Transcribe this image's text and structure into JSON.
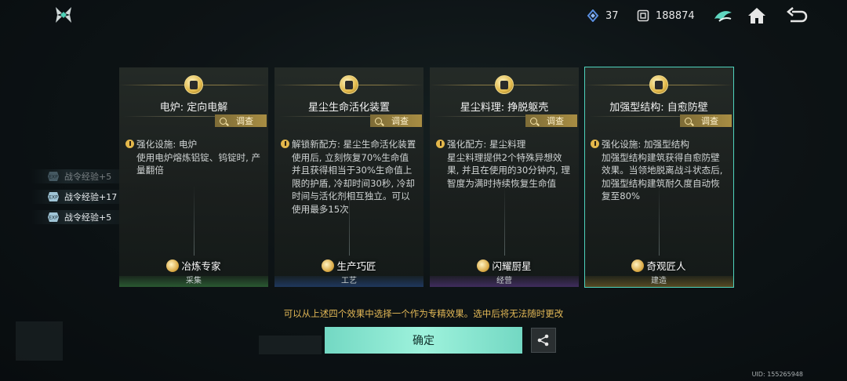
{
  "topbar": {
    "resource_a_value": "37",
    "resource_b_value": "188874",
    "icons": [
      "logo-icon",
      "crystal-icon",
      "coin-icon",
      "fleet-icon",
      "home-icon",
      "back-icon"
    ]
  },
  "exp_list": [
    {
      "label": "战令经验+5",
      "faded": true
    },
    {
      "label": "战令经验+17",
      "faded": false
    },
    {
      "label": "战令经验+5",
      "faded": false
    }
  ],
  "cards": [
    {
      "title": "电炉: 定向电解",
      "inspect_label": "调查",
      "effect_head": "强化设施: 电炉",
      "effect_desc": "使用电炉熔炼铝锭、钨锭时, 产量翻倍",
      "role": "冶炼专家",
      "category": "采集",
      "selected": false
    },
    {
      "title": "星尘生命活化装置",
      "inspect_label": "调查",
      "effect_head": "解锁新配方: 星尘生命活化装置",
      "effect_desc": "使用后, 立刻恢复70%生命值并且获得相当于30%生命值上限的护盾, 冷却时间30秒, 冷却时间与活化剂相互独立。可以使用最多15次",
      "role": "生产巧匠",
      "category": "工艺",
      "selected": false
    },
    {
      "title": "星尘料理: 挣脱躯壳",
      "inspect_label": "调查",
      "effect_head": "强化配方: 星尘料理",
      "effect_desc": "星尘料理提供2个特殊异想效果, 并且在使用的30分钟内, 理智度为满时持续恢复生命值",
      "role": "闪耀厨星",
      "category": "经营",
      "selected": false
    },
    {
      "title": "加强型结构: 自愈防壁",
      "inspect_label": "调查",
      "effect_head": "强化设施: 加强型结构",
      "effect_desc": "加强型结构建筑获得自愈防壁效果。当领地脱离战斗状态后, 加强型结构建筑耐久度自动恢复至80%",
      "role": "奇观匠人",
      "category": "建造",
      "selected": true
    }
  ],
  "notice": "可以从上述四个效果中选择一个作为专精效果。选中后将无法随时更改",
  "confirm_label": "确定",
  "uid": "UID: 155265948",
  "colors": {
    "accent": "#53d9c1",
    "gold": "#e3b856",
    "confirm_bg": "#8ee6d2"
  }
}
